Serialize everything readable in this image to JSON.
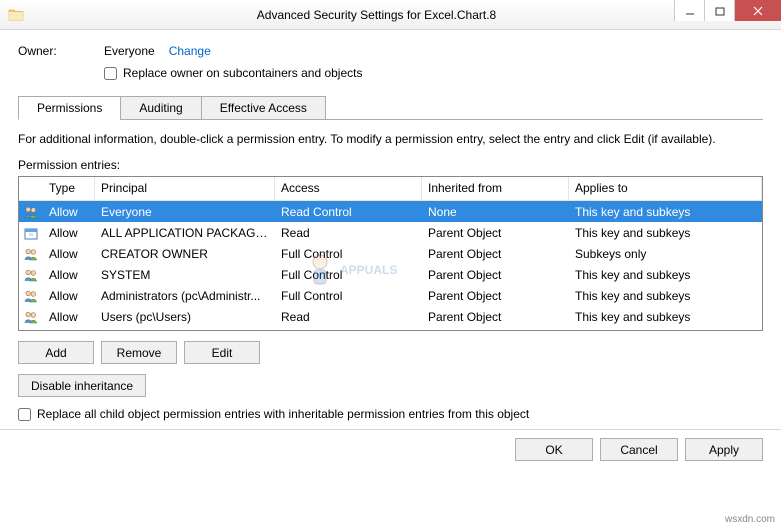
{
  "window": {
    "title": "Advanced Security Settings for Excel.Chart.8"
  },
  "owner": {
    "label": "Owner:",
    "value": "Everyone",
    "changeLink": "Change",
    "replaceCheckbox": "Replace owner on subcontainers and objects"
  },
  "tabs": {
    "permissions": "Permissions",
    "auditing": "Auditing",
    "effectiveAccess": "Effective Access"
  },
  "description": "For additional information, double-click a permission entry. To modify a permission entry, select the entry and click Edit (if available).",
  "entriesLabel": "Permission entries:",
  "columns": {
    "type": "Type",
    "principal": "Principal",
    "access": "Access",
    "inherited": "Inherited from",
    "applies": "Applies to"
  },
  "rows": [
    {
      "type": "Allow",
      "principal": "Everyone",
      "access": "Read Control",
      "inherited": "None",
      "applies": "This key and subkeys",
      "selected": true,
      "icon": "group"
    },
    {
      "type": "Allow",
      "principal": "ALL APPLICATION PACKAGES",
      "access": "Read",
      "inherited": "Parent Object",
      "applies": "This key and subkeys",
      "selected": false,
      "icon": "package"
    },
    {
      "type": "Allow",
      "principal": "CREATOR OWNER",
      "access": "Full Control",
      "inherited": "Parent Object",
      "applies": "Subkeys only",
      "selected": false,
      "icon": "group"
    },
    {
      "type": "Allow",
      "principal": "SYSTEM",
      "access": "Full Control",
      "inherited": "Parent Object",
      "applies": "This key and subkeys",
      "selected": false,
      "icon": "group"
    },
    {
      "type": "Allow",
      "principal": "Administrators (pc\\Administr...",
      "access": "Full Control",
      "inherited": "Parent Object",
      "applies": "This key and subkeys",
      "selected": false,
      "icon": "group"
    },
    {
      "type": "Allow",
      "principal": "Users (pc\\Users)",
      "access": "Read",
      "inherited": "Parent Object",
      "applies": "This key and subkeys",
      "selected": false,
      "icon": "group"
    }
  ],
  "buttons": {
    "add": "Add",
    "remove": "Remove",
    "edit": "Edit",
    "disableInheritance": "Disable inheritance",
    "ok": "OK",
    "cancel": "Cancel",
    "apply": "Apply"
  },
  "replaceChild": "Replace all child object permission entries with inheritable permission entries from this object",
  "watermark": "wsxdn.com",
  "appuals": "APPUALS"
}
